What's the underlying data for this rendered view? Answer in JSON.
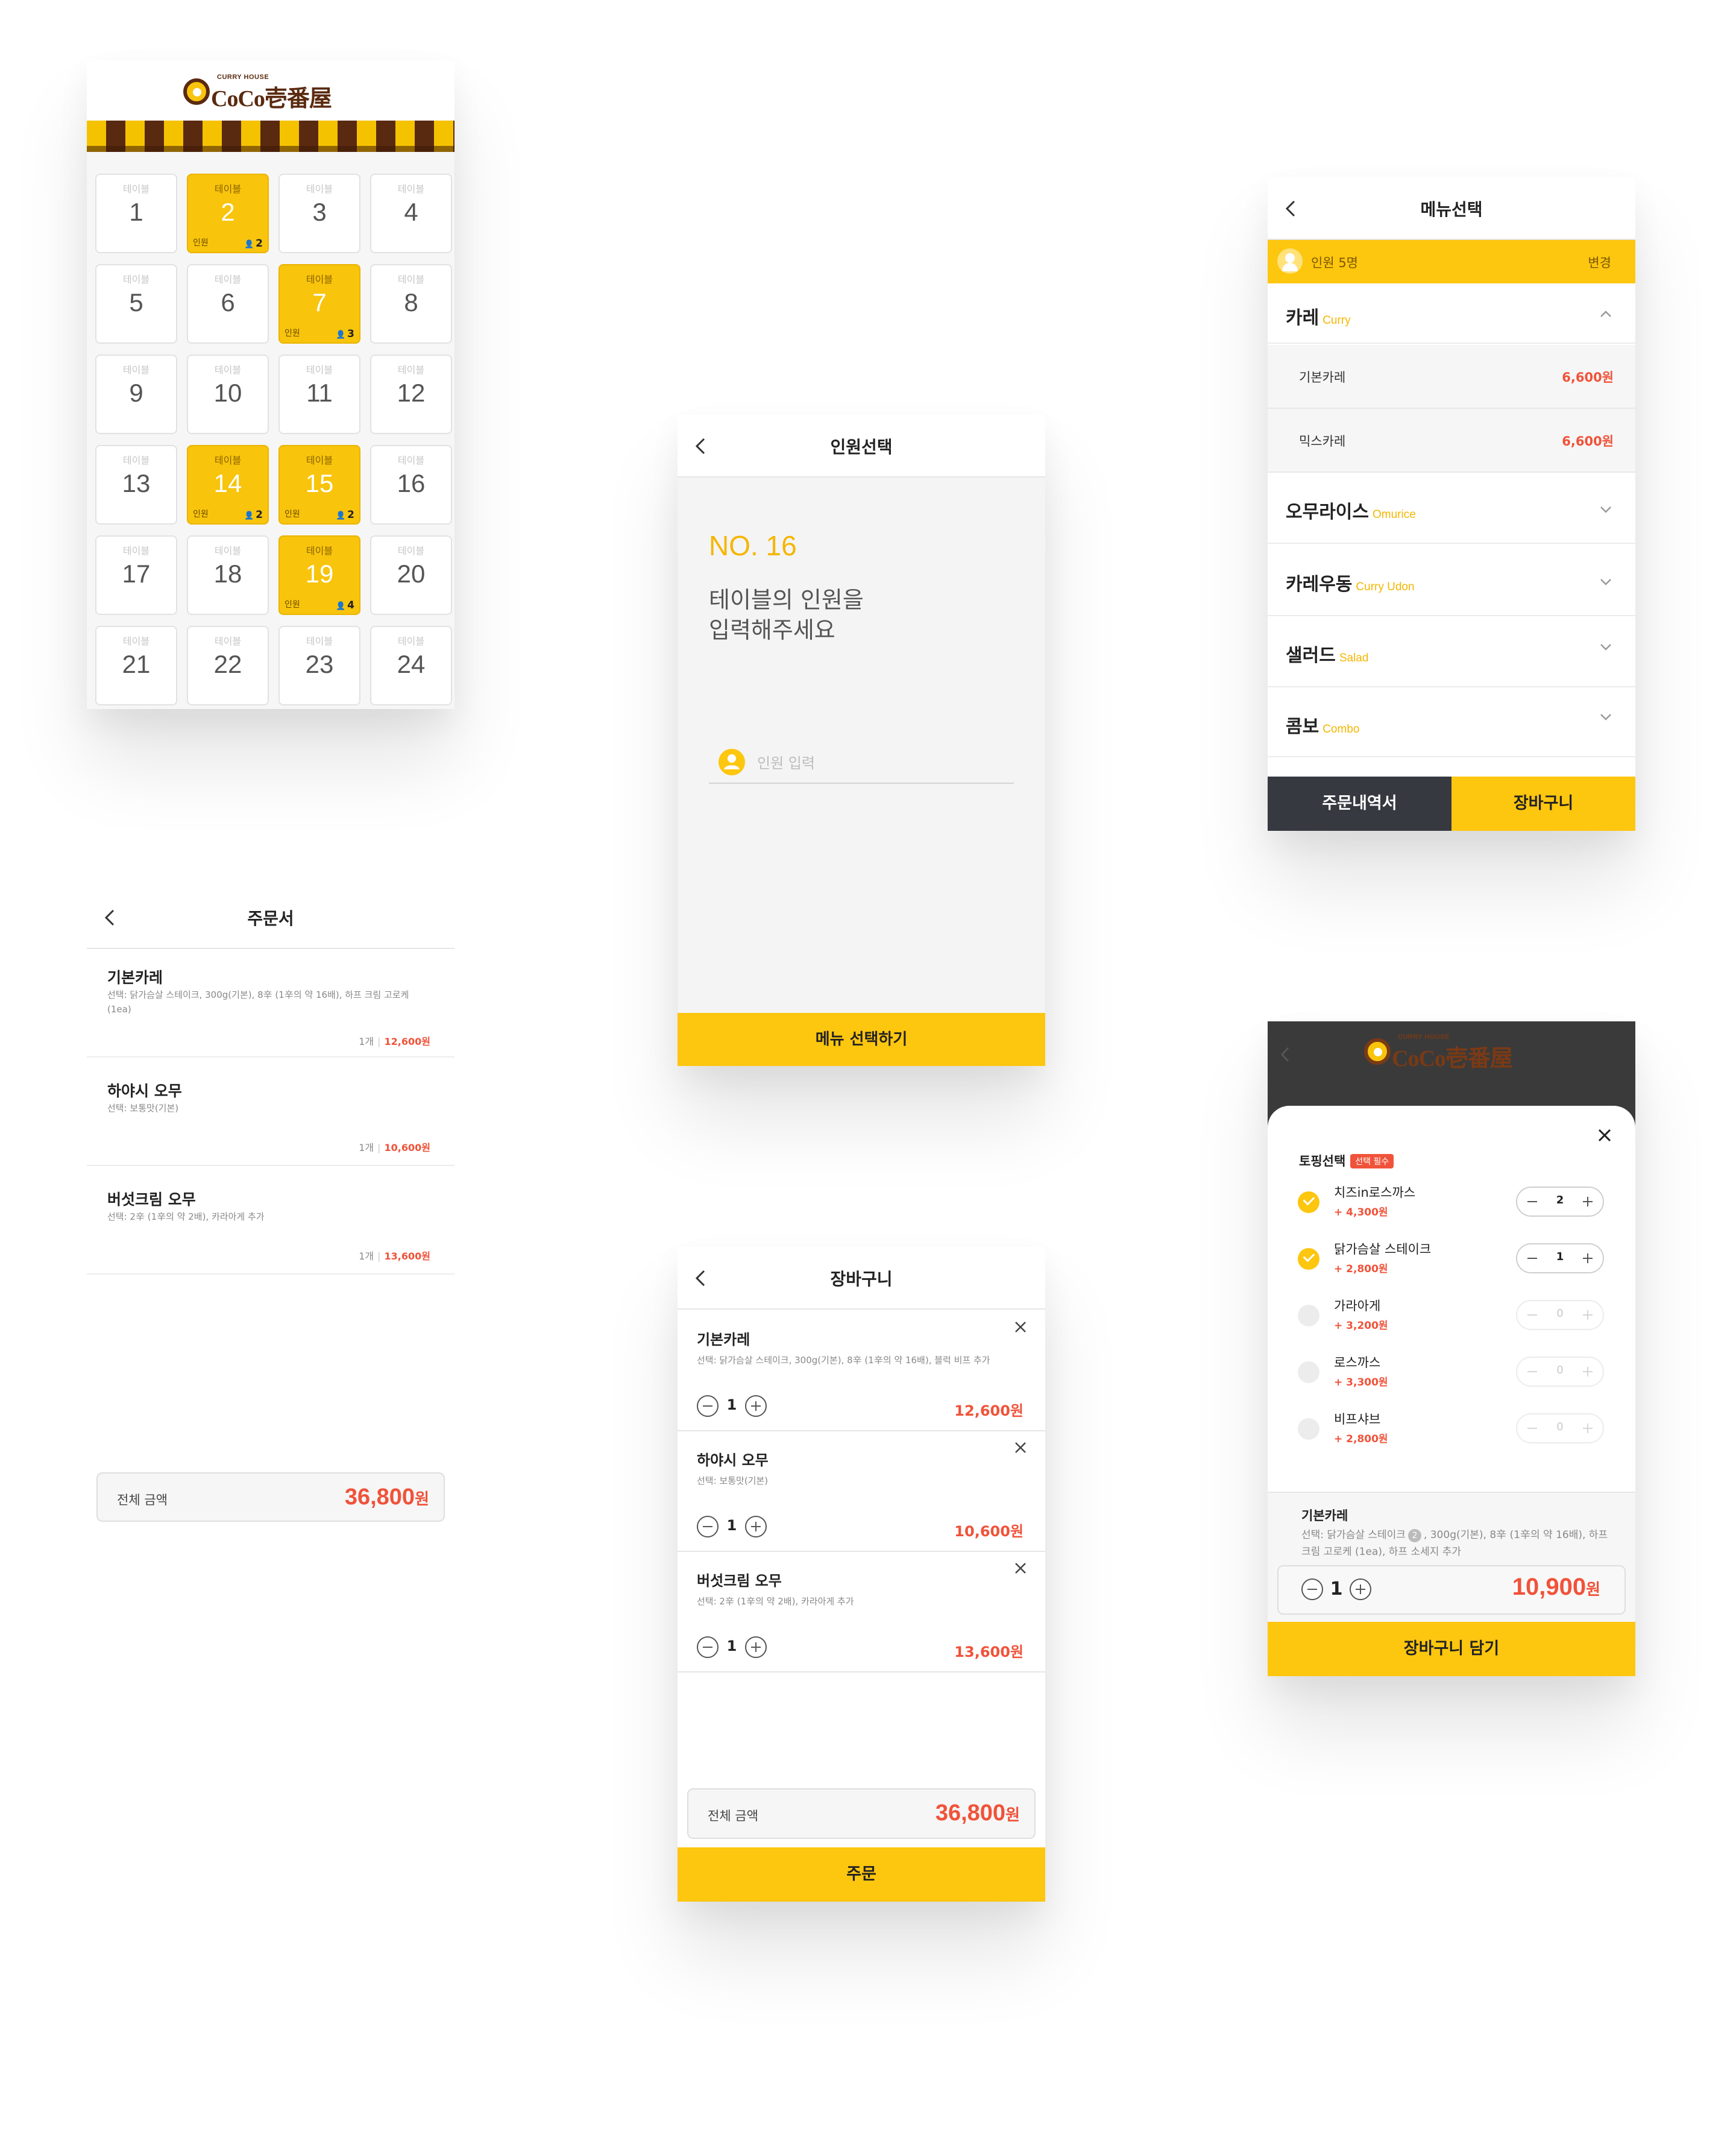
{
  "brand": {
    "small": "CURRY HOUSE",
    "big": "CoCo壱番屋"
  },
  "tables_screen": {
    "tables": [
      {
        "label": "테이블",
        "number": "1",
        "occupied": false
      },
      {
        "label": "테이블",
        "number": "2",
        "occupied": true,
        "guest_label": "인원",
        "guests": "2"
      },
      {
        "label": "테이블",
        "number": "3",
        "occupied": false
      },
      {
        "label": "테이블",
        "number": "4",
        "occupied": false
      },
      {
        "label": "테이블",
        "number": "5",
        "occupied": false
      },
      {
        "label": "테이블",
        "number": "6",
        "occupied": false
      },
      {
        "label": "테이블",
        "number": "7",
        "occupied": true,
        "guest_label": "인원",
        "guests": "3"
      },
      {
        "label": "테이블",
        "number": "8",
        "occupied": false
      },
      {
        "label": "테이블",
        "number": "9",
        "occupied": false
      },
      {
        "label": "테이블",
        "number": "10",
        "occupied": false
      },
      {
        "label": "테이블",
        "number": "11",
        "occupied": false
      },
      {
        "label": "테이블",
        "number": "12",
        "occupied": false
      },
      {
        "label": "테이블",
        "number": "13",
        "occupied": false
      },
      {
        "label": "테이블",
        "number": "14",
        "occupied": true,
        "guest_label": "인원",
        "guests": "2"
      },
      {
        "label": "테이블",
        "number": "15",
        "occupied": true,
        "guest_label": "인원",
        "guests": "2"
      },
      {
        "label": "테이블",
        "number": "16",
        "occupied": false
      },
      {
        "label": "테이블",
        "number": "17",
        "occupied": false
      },
      {
        "label": "테이블",
        "number": "18",
        "occupied": false
      },
      {
        "label": "테이블",
        "number": "19",
        "occupied": true,
        "guest_label": "인원",
        "guests": "4"
      },
      {
        "label": "테이블",
        "number": "20",
        "occupied": false
      },
      {
        "label": "테이블",
        "number": "21",
        "occupied": false
      },
      {
        "label": "테이블",
        "number": "22",
        "occupied": false
      },
      {
        "label": "테이블",
        "number": "23",
        "occupied": false
      },
      {
        "label": "테이블",
        "number": "24",
        "occupied": false
      }
    ]
  },
  "person_screen": {
    "title": "인원선택",
    "table_no": "NO. 16",
    "prompt_line1": "테이블의 인원을",
    "prompt_line2": "입력해주세요",
    "input_placeholder": "인원 입력",
    "input_value": "",
    "submit_label": "메뉴 선택하기"
  },
  "menu_screen": {
    "title": "메뉴선택",
    "people_label": "인원 5명",
    "change_label": "변경",
    "categories": [
      {
        "ko": "카레",
        "en": "Curry",
        "expanded": true
      },
      {
        "ko": "오무라이스",
        "en": "Omurice",
        "expanded": false
      },
      {
        "ko": "카레우동",
        "en": "Curry Udon",
        "expanded": false
      },
      {
        "ko": "샐러드",
        "en": "Salad",
        "expanded": false
      },
      {
        "ko": "콤보",
        "en": "Combo",
        "expanded": false
      }
    ],
    "curry_items": [
      {
        "name": "기본카레",
        "price": "6,600원"
      },
      {
        "name": "믹스카레",
        "price": "6,600원"
      }
    ],
    "order_history_label": "주문내역서",
    "cart_label": "장바구니"
  },
  "order_sheet": {
    "title": "주문서",
    "items": [
      {
        "name": "기본카레",
        "desc": "선택: 닭가슴살 스테이크, 300g(기본), 8辛 (1辛의 약 16배), 하프 크림 고로케 (1ea)",
        "qty": "1개",
        "price": "12,600원"
      },
      {
        "name": "하야시 오무",
        "desc": "선택: 보통맛(기본)",
        "qty": "1개",
        "price": "10,600원"
      },
      {
        "name": "버섯크림 오무",
        "desc": "선택: 2辛 (1辛의 약 2배), 카라아게 추가",
        "qty": "1개",
        "price": "13,600원"
      }
    ],
    "total_label": "전체 금액",
    "total_value": "36,800",
    "total_unit": "원"
  },
  "cart": {
    "title": "장바구니",
    "items": [
      {
        "name": "기본카레",
        "desc": "선택: 닭가슴살 스테이크, 300g(기본), 8辛 (1辛의 약 16배), 블럭 비프 추가",
        "qty": "1",
        "price": "12,600원"
      },
      {
        "name": "하야시 오무",
        "desc": "선택: 보통맛(기본)",
        "qty": "1",
        "price": "10,600원"
      },
      {
        "name": "버섯크림 오무",
        "desc": "선택: 2辛 (1辛의 약 2배), 카라아게 추가",
        "qty": "1",
        "price": "13,600원"
      }
    ],
    "total_label": "전체 금액",
    "total_value": "36,800",
    "total_unit": "원",
    "order_label": "주문"
  },
  "topping_modal": {
    "section_title": "토핑선택",
    "required_badge": "선택 필수",
    "toppings": [
      {
        "name": "치즈in로스까스",
        "price": "+ 4,300원",
        "qty": "2",
        "selected": true
      },
      {
        "name": "닭가슴살 스테이크",
        "price": "+ 2,800원",
        "qty": "1",
        "selected": true
      },
      {
        "name": "가라아게",
        "price": "+ 3,200원",
        "qty": "0",
        "selected": false
      },
      {
        "name": "로스까스",
        "price": "+ 3,300원",
        "qty": "0",
        "selected": false
      },
      {
        "name": "비프샤브",
        "price": "+ 2,800원",
        "qty": "0",
        "selected": false
      }
    ],
    "summary_name": "기본카레",
    "summary_desc_a": "선택: 닭가슴살 스테이크",
    "summary_badge": "2",
    "summary_desc_b": ", 300g(기본), 8辛 (1辛의 약 16배), 하프 크림 고로케 (1ea), 하프 소세지 추가",
    "qty": "1",
    "price_value": "10,900",
    "price_unit": "원",
    "add_label": "장바구니 담기"
  },
  "colors": {
    "accent": "#fdc60f",
    "price": "#f0533a",
    "brand_brown": "#5a2a10",
    "dark_bar": "#363940"
  }
}
